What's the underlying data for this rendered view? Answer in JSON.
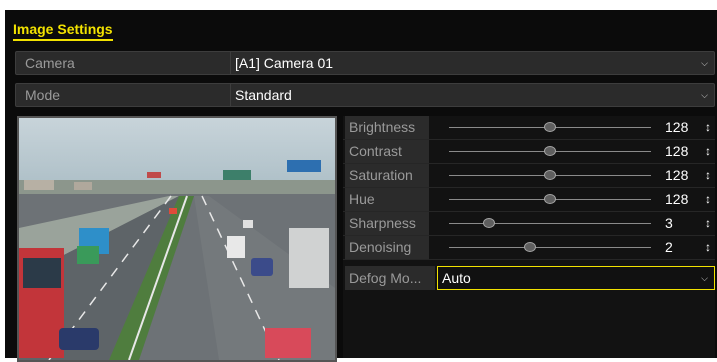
{
  "window": {
    "title": "Image Settings"
  },
  "camera_field": {
    "label": "Camera",
    "value": "[A1] Camera 01"
  },
  "mode_field": {
    "label": "Mode",
    "value": "Standard"
  },
  "adjustments": [
    {
      "label": "Brightness",
      "value": "128",
      "level": 0.5
    },
    {
      "label": "Contrast",
      "value": "128",
      "level": 0.5
    },
    {
      "label": "Saturation",
      "value": "128",
      "level": 0.5
    },
    {
      "label": "Hue",
      "value": "128",
      "level": 0.5
    },
    {
      "label": "Sharpness",
      "value": "3",
      "level": 0.2
    },
    {
      "label": "Denoising",
      "value": "2",
      "level": 0.4
    }
  ],
  "defog_field": {
    "label": "Defog Mo...",
    "value": "Auto"
  },
  "colors": {
    "accent": "#f2e200",
    "panel": "#0b0b0b",
    "field": "#2b2b2b"
  },
  "icons": {
    "dropdown": "chevron-down-icon",
    "spinner": "spinner-icon"
  }
}
